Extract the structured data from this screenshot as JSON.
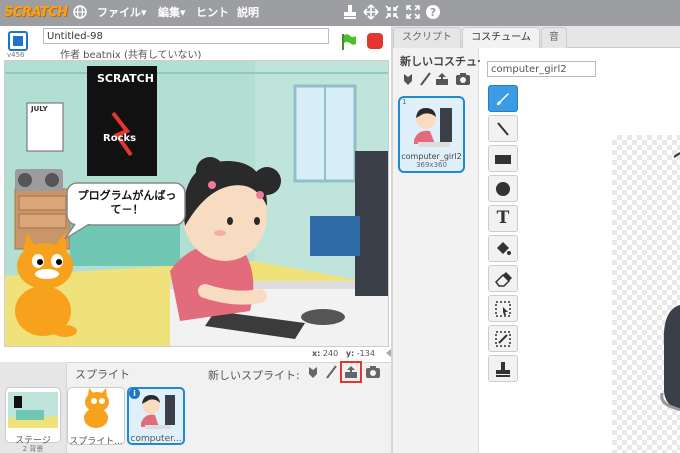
{
  "menubar": {
    "logo": "SCRATCH",
    "menus": [
      "ファイル▾",
      "編集▾",
      "ヒント",
      "説明"
    ]
  },
  "project": {
    "title": "Untitled-98",
    "author": "作者 beatnix (共有していない)",
    "version": "v456"
  },
  "stage": {
    "speech": "プログラムがんばって－！",
    "poster_line1": "SCRATCH",
    "poster_line2": "Rocks",
    "calendar": "JULY",
    "coords_label_x": "x:",
    "coords_x": "240",
    "coords_label_y": "y:",
    "coords_y": "-134"
  },
  "sprites": {
    "label": "スプライト",
    "new_label": "新しいスプライト:",
    "stage_thumb_label": "ステージ",
    "stage_thumb_sub": "2 背景",
    "items": [
      {
        "label": "スプライト..."
      },
      {
        "label": "computer..."
      }
    ]
  },
  "tabs": {
    "script": "スクリプト",
    "costume": "コスチューム",
    "sound": "音"
  },
  "costumes": {
    "new_label": "新しいコスチューム:",
    "name_field": "computer_girl2",
    "items": [
      {
        "num": "1",
        "name": "computer_girl2",
        "size": "369x360"
      }
    ]
  },
  "colors": {
    "menubar": "#9c9ea2",
    "accent_blue": "#1e8ad6",
    "stop_red": "#e2372f",
    "scratch_orange": "#f7a11c"
  }
}
